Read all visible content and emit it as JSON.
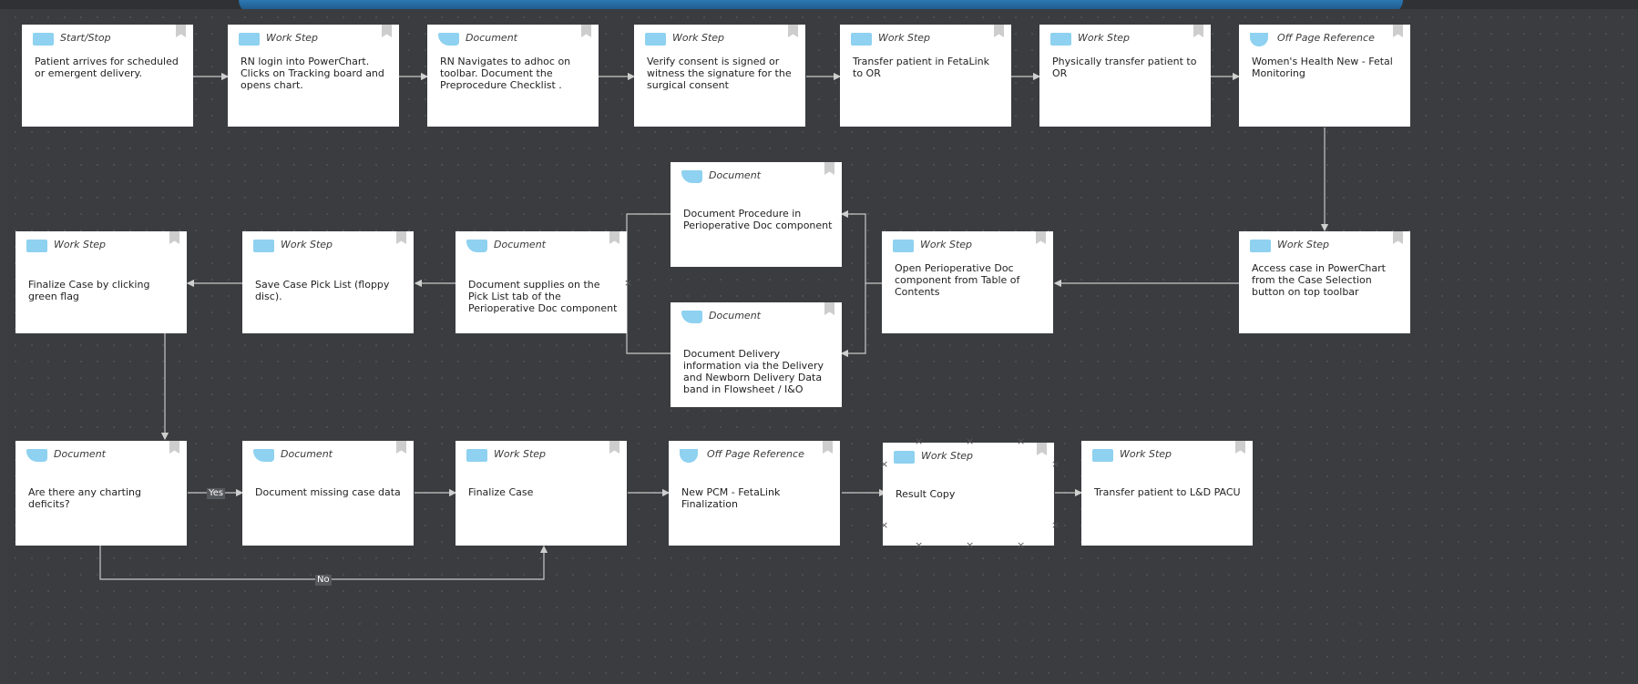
{
  "diagram": {
    "nodes": [
      {
        "id": "n1",
        "type": "Start/Stop",
        "text": "Patient arrives for scheduled or emergent delivery.",
        "shape": "work"
      },
      {
        "id": "n2",
        "type": "Work Step",
        "text": "RN login into PowerChart. Clicks on Tracking board and opens chart.",
        "shape": "work"
      },
      {
        "id": "n3",
        "type": "Document",
        "text": "RN Navigates to adhoc on toolbar. Document the Preprocedure Checklist .",
        "shape": "doc"
      },
      {
        "id": "n4",
        "type": "Work Step",
        "text": "Verify consent is signed or witness the signature for the surgical consent",
        "shape": "work"
      },
      {
        "id": "n5",
        "type": "Work Step",
        "text": "Transfer patient in FetaLink to OR",
        "shape": "work"
      },
      {
        "id": "n6",
        "type": "Work Step",
        "text": "Physically transfer patient to OR",
        "shape": "work"
      },
      {
        "id": "n7",
        "type": "Off Page Reference",
        "text": "Women's Health New - Fetal Monitoring",
        "shape": "offpage"
      },
      {
        "id": "n8",
        "type": "Work Step",
        "text": "Access case in PowerChart from the Case Selection button on top toolbar",
        "shape": "work"
      },
      {
        "id": "n9",
        "type": "Work Step",
        "text": "Open Perioperative Doc component from Table of Contents",
        "shape": "work"
      },
      {
        "id": "n10",
        "type": "Document",
        "text": "Document Procedure in Perioperative Doc component",
        "shape": "doc"
      },
      {
        "id": "n11",
        "type": "Document",
        "text": "Document Delivery information via the Delivery and Newborn Delivery Data band in Flowsheet / I&O",
        "shape": "doc"
      },
      {
        "id": "n12",
        "type": "Document",
        "text": "Document supplies on the Pick List tab of the Perioperative Doc component",
        "shape": "doc"
      },
      {
        "id": "n13",
        "type": "Work Step",
        "text": "Save Case Pick List (floppy disc).",
        "shape": "work"
      },
      {
        "id": "n14",
        "type": "Work Step",
        "text": "Finalize Case by clicking green flag",
        "shape": "work"
      },
      {
        "id": "n15",
        "type": "Document",
        "text": "Are there any charting deficits?",
        "shape": "doc"
      },
      {
        "id": "n16",
        "type": "Document",
        "text": "Document missing case data",
        "shape": "doc"
      },
      {
        "id": "n17",
        "type": "Work Step",
        "text": "Finalize Case",
        "shape": "work"
      },
      {
        "id": "n18",
        "type": "Off Page Reference",
        "text": "New PCM - FetaLink Finalization",
        "shape": "offpage"
      },
      {
        "id": "n19",
        "type": "Work Step",
        "text": "Result Copy",
        "shape": "work"
      },
      {
        "id": "n20",
        "type": "Work Step",
        "text": "Transfer patient  to L&D PACU",
        "shape": "work"
      }
    ],
    "edge_labels": {
      "yes": "Yes",
      "no": "No"
    },
    "colors": {
      "background": "#3a3c3f",
      "node": "#ffffff",
      "badge": "#8ed1f0",
      "wire": "#c8c8c8",
      "topbar": "#2c77b2"
    }
  }
}
